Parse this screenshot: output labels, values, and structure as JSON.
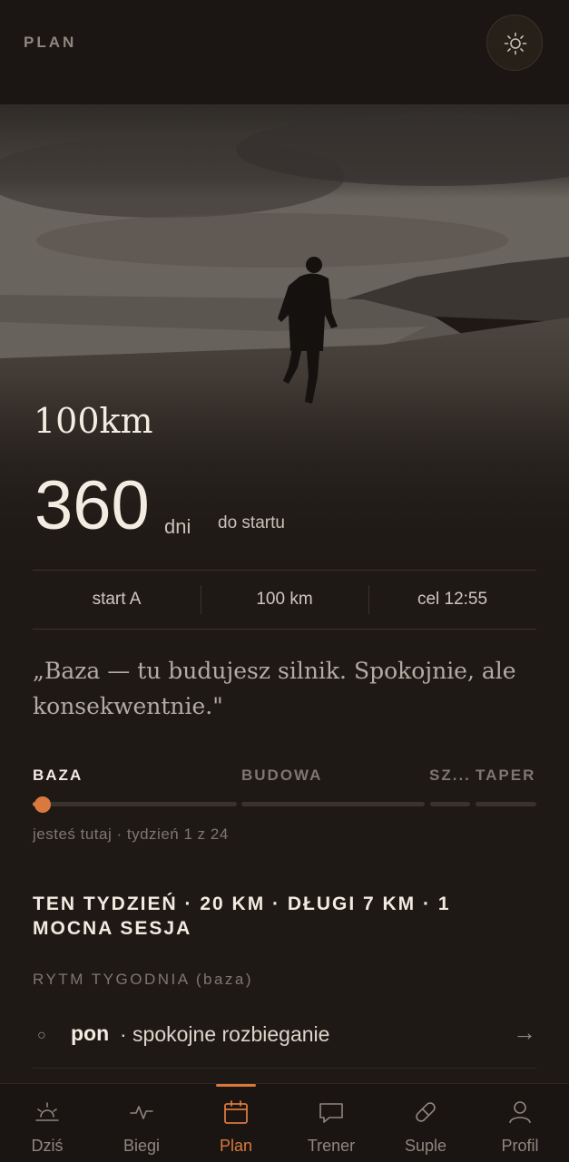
{
  "header": {
    "title": "PLAN",
    "theme_icon": "sun-icon"
  },
  "hero": {
    "race_name": "100km",
    "countdown": {
      "value": "360",
      "unit": "dni",
      "label": "do startu"
    }
  },
  "stats": [
    "start A",
    "100 km",
    "cel 12:55"
  ],
  "quote": "„Baza — tu budujesz silnik. Spokojnie, ale konsekwentnie.\"",
  "phases": {
    "items": [
      "BAZA",
      "BUDOWA",
      "SZ...",
      "TAPER"
    ],
    "current": "BAZA",
    "progress_text": "jesteś tutaj · tydzień 1 z 24"
  },
  "week_summary": "TEN TYDZIEŃ · 20 KM · DŁUGI 7 KM · 1 MOCNA SESJA",
  "rhythm": {
    "title": "RYTM TYGODNIA (baza)",
    "rows": [
      {
        "day": "pon",
        "desc": "· spokojne rozbieganie",
        "arrow": "→"
      }
    ]
  },
  "tabs": [
    {
      "label": "Dziś",
      "icon": "sunrise-icon"
    },
    {
      "label": "Biegi",
      "icon": "pulse-icon"
    },
    {
      "label": "Plan",
      "icon": "calendar-icon",
      "active": true
    },
    {
      "label": "Trener",
      "icon": "chat-icon"
    },
    {
      "label": "Suple",
      "icon": "pill-icon"
    },
    {
      "label": "Profil",
      "icon": "user-icon"
    }
  ],
  "colors": {
    "accent": "#d9793d",
    "background": "#1f1916"
  }
}
